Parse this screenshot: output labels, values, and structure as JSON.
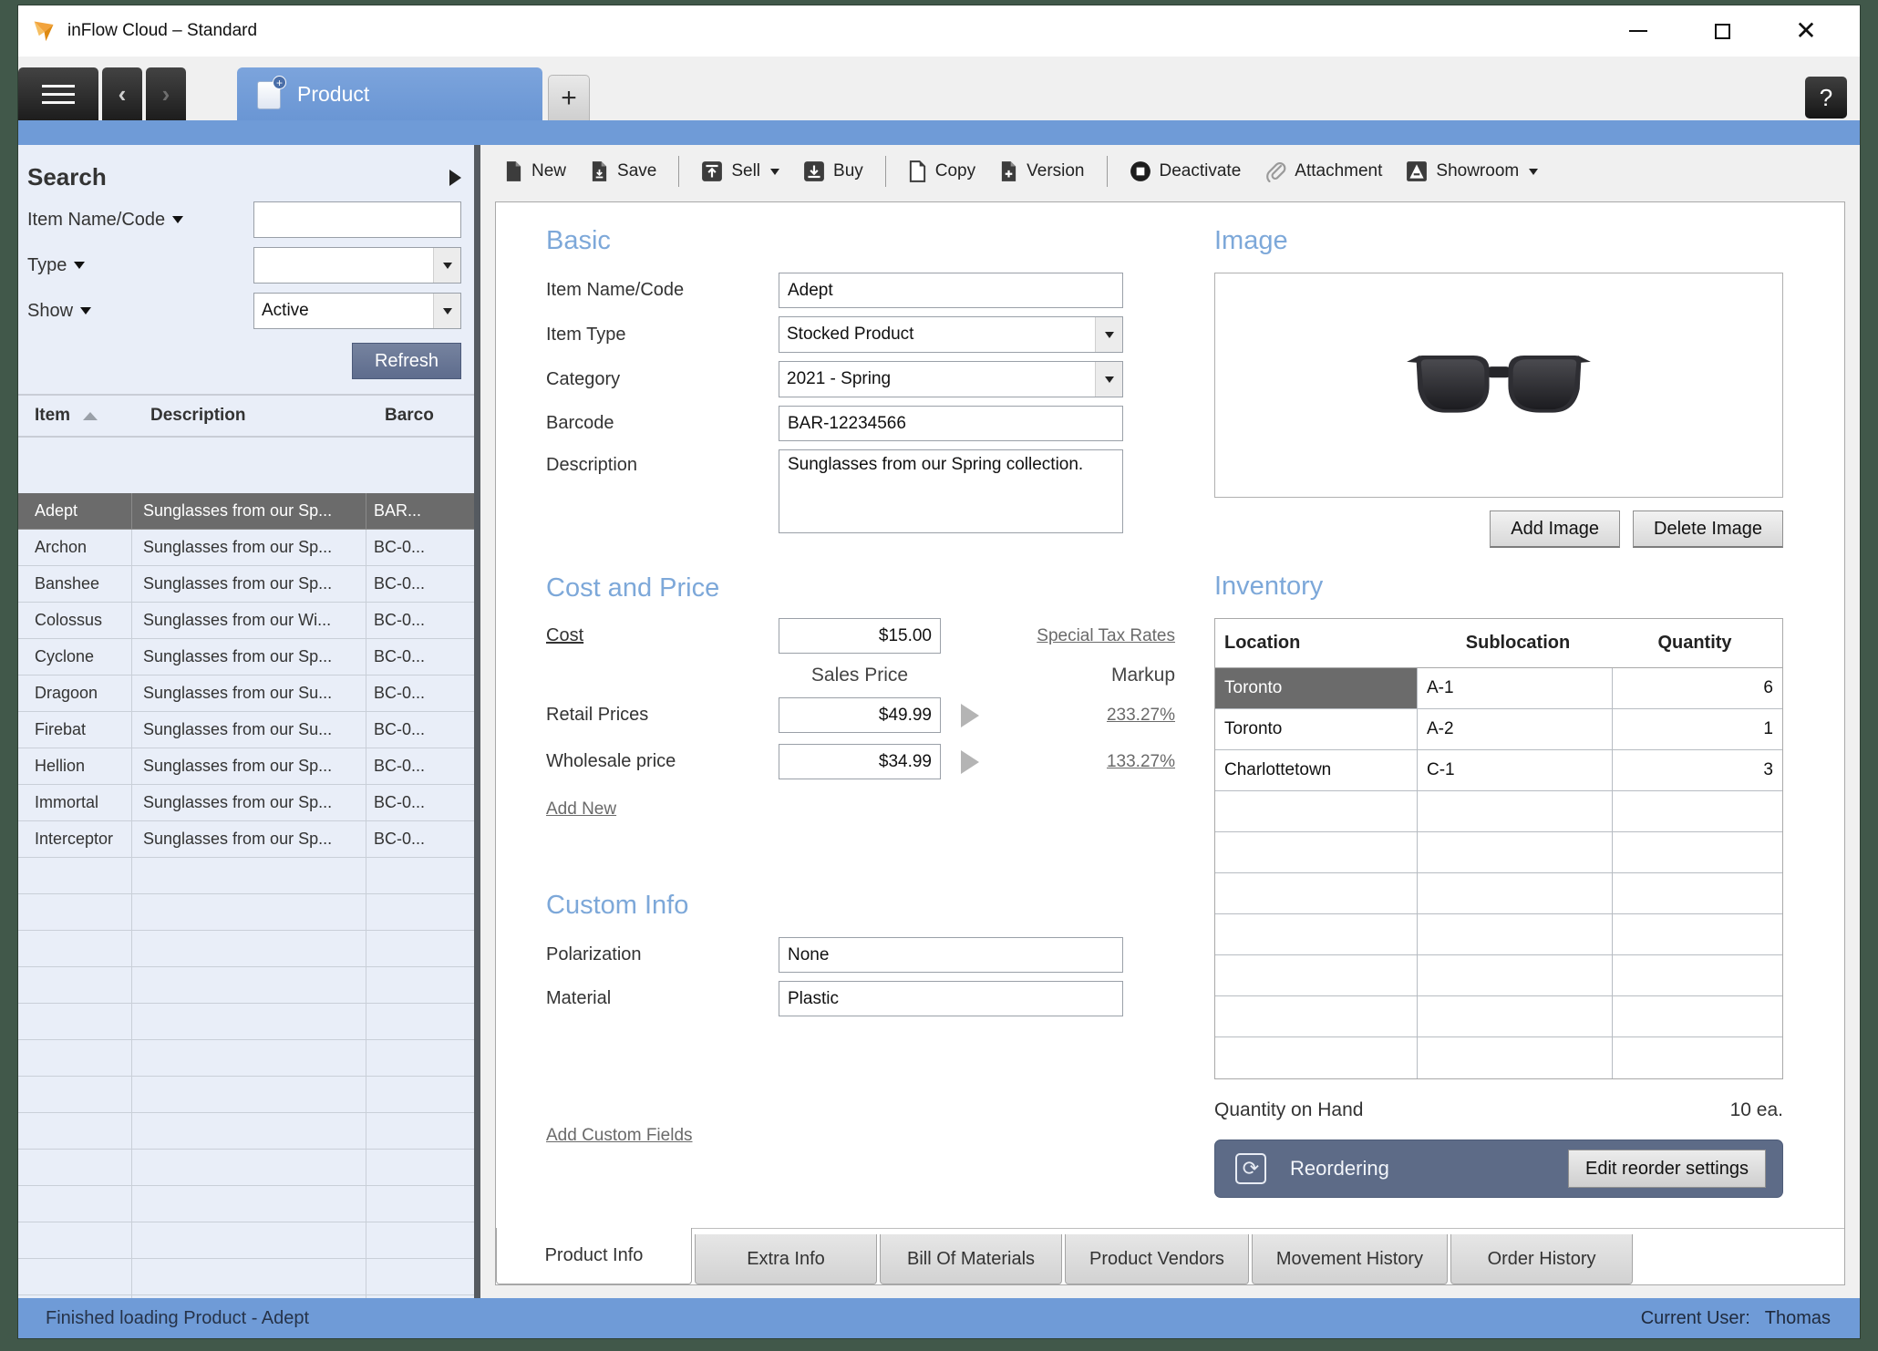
{
  "window": {
    "title": "inFlow Cloud – Standard"
  },
  "tabbar": {
    "product_tab": "Product",
    "new_tab": "+",
    "help": "?"
  },
  "search": {
    "title": "Search",
    "item_name_label": "Item Name/Code",
    "item_name_value": "",
    "type_label": "Type",
    "type_value": "",
    "show_label": "Show",
    "show_value": "Active",
    "refresh": "Refresh"
  },
  "list": {
    "col_item": "Item",
    "col_description": "Description",
    "col_barcode": "Barco",
    "rows": [
      {
        "item": "Adept",
        "description": "Sunglasses from our Sp...",
        "barcode": "BAR..."
      },
      {
        "item": "Archon",
        "description": "Sunglasses from our Sp...",
        "barcode": "BC-0..."
      },
      {
        "item": "Banshee",
        "description": "Sunglasses from our Sp...",
        "barcode": "BC-0..."
      },
      {
        "item": "Colossus",
        "description": "Sunglasses from our Wi...",
        "barcode": "BC-0..."
      },
      {
        "item": "Cyclone",
        "description": "Sunglasses from our Sp...",
        "barcode": "BC-0..."
      },
      {
        "item": "Dragoon",
        "description": "Sunglasses from our Su...",
        "barcode": "BC-0..."
      },
      {
        "item": "Firebat",
        "description": "Sunglasses from our Su...",
        "barcode": "BC-0..."
      },
      {
        "item": "Hellion",
        "description": "Sunglasses from our Sp...",
        "barcode": "BC-0..."
      },
      {
        "item": "Immortal",
        "description": "Sunglasses from our Sp...",
        "barcode": "BC-0..."
      },
      {
        "item": "Interceptor",
        "description": "Sunglasses from our Sp...",
        "barcode": "BC-0..."
      }
    ]
  },
  "toolbar": {
    "new": "New",
    "save": "Save",
    "sell": "Sell",
    "buy": "Buy",
    "copy": "Copy",
    "version": "Version",
    "deactivate": "Deactivate",
    "attachment": "Attachment",
    "showroom": "Showroom"
  },
  "basic": {
    "heading": "Basic",
    "item_name_label": "Item Name/Code",
    "item_name": "Adept",
    "item_type_label": "Item Type",
    "item_type": "Stocked Product",
    "category_label": "Category",
    "category": "2021 - Spring",
    "barcode_label": "Barcode",
    "barcode": "BAR-12234566",
    "description_label": "Description",
    "description": "Sunglasses from our Spring collection."
  },
  "cost_price": {
    "heading": "Cost and Price",
    "cost_label": "Cost",
    "cost": "$15.00",
    "special_tax": "Special Tax Rates",
    "sales_price_header": "Sales Price",
    "markup_header": "Markup",
    "retail_label": "Retail Prices",
    "retail": "$49.99",
    "retail_markup": "233.27%",
    "wholesale_label": "Wholesale price",
    "wholesale": "$34.99",
    "wholesale_markup": "133.27%",
    "add_new": "Add New"
  },
  "custom_info": {
    "heading": "Custom Info",
    "polarization_label": "Polarization",
    "polarization": "None",
    "material_label": "Material",
    "material": "Plastic",
    "add_custom_fields": "Add Custom Fields"
  },
  "image_section": {
    "heading": "Image",
    "add": "Add Image",
    "delete": "Delete Image"
  },
  "inventory": {
    "heading": "Inventory",
    "col_location": "Location",
    "col_sublocation": "Sublocation",
    "col_quantity": "Quantity",
    "rows": [
      {
        "location": "Toronto",
        "sublocation": "A-1",
        "quantity": "6"
      },
      {
        "location": "Toronto",
        "sublocation": "A-2",
        "quantity": "1"
      },
      {
        "location": "Charlottetown",
        "sublocation": "C-1",
        "quantity": "3"
      }
    ],
    "qoh_label": "Quantity on Hand",
    "qoh_value": "10 ea.",
    "reordering_label": "Reordering",
    "edit_reorder": "Edit reorder settings"
  },
  "bottom_tabs": {
    "tabs": [
      {
        "label": "Product Info"
      },
      {
        "label": "Extra Info"
      },
      {
        "label": "Bill Of Materials"
      },
      {
        "label": "Product Vendors"
      },
      {
        "label": "Movement History"
      },
      {
        "label": "Order History"
      }
    ]
  },
  "statusbar": {
    "left": "Finished loading Product - Adept",
    "right_label": "Current User:",
    "right_value": "Thomas"
  },
  "colors": {
    "accent_blue": "#6f9bd7",
    "heading_blue": "#7da8d9",
    "selected_row": "#6b6b6b",
    "refresh_button": "#68779a",
    "reorder_bar": "#5d6b87",
    "frame_green": "#41584a"
  }
}
